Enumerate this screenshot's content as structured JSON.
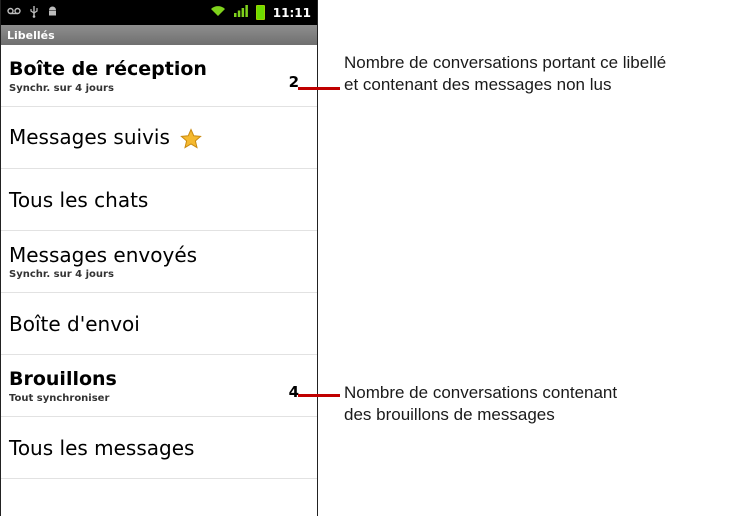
{
  "statusbar": {
    "time": "11:11",
    "icons": [
      "voicemail-icon",
      "usb-icon",
      "android-debug-icon",
      "wifi-icon",
      "signal-icon",
      "battery-icon"
    ]
  },
  "titlebar": {
    "title": "Libellés"
  },
  "labels": [
    {
      "name": "Boîte de réception",
      "sub": "Synchr. sur 4 jours",
      "count": "2",
      "bold": true
    },
    {
      "name": "Messages suivis",
      "sub": "",
      "count": "",
      "bold": false,
      "icon": "star-icon"
    },
    {
      "name": "Tous les chats",
      "sub": "",
      "count": "",
      "bold": false
    },
    {
      "name": "Messages envoyés",
      "sub": "Synchr. sur 4 jours",
      "count": "",
      "bold": false
    },
    {
      "name": "Boîte d'envoi",
      "sub": "",
      "count": "",
      "bold": false
    },
    {
      "name": "Brouillons",
      "sub": "Tout synchroniser",
      "count": "4",
      "bold": true
    },
    {
      "name": "Tous les messages",
      "sub": "",
      "count": "",
      "bold": false
    }
  ],
  "callouts": {
    "unread": {
      "line1": "Nombre de conversations portant ce libellé",
      "line2": "et contenant des messages non lus"
    },
    "drafts": {
      "line1": "Nombre de conversations contenant",
      "line2": "des brouillons de messages"
    }
  },
  "colors": {
    "accent": "#c00000",
    "titlebar": "#7f7f7f",
    "battery": "#6ddc00"
  }
}
